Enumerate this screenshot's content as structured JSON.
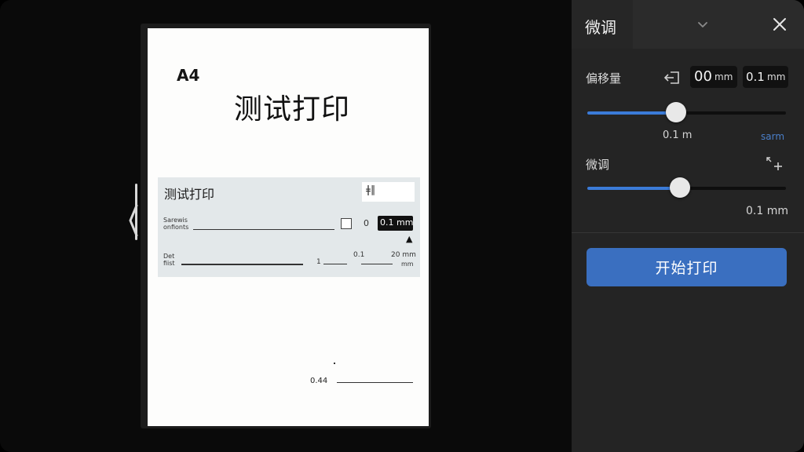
{
  "preview": {
    "paper_size": "A4",
    "title": "测试打印",
    "band": {
      "title": "测试打印",
      "glyph": "ǂ∥",
      "row1_label_a": "Sarewis",
      "row1_label_b": "onfionts",
      "small_num": "0",
      "value_pill": "0.1 mm",
      "row2_label_a": "Det",
      "row2_label_b": "fiist",
      "row2_num_1": "1",
      "row2_num_2": "0.1",
      "row2_num_3": "20 mm",
      "row2_unit": "mm"
    },
    "bottom_number": "0.44"
  },
  "panel": {
    "title": "微调",
    "offset": {
      "label": "偏移量",
      "value1_num": "00",
      "value1_unit": "mm",
      "value2_num": "0.1",
      "value2_unit": "mm",
      "slider_fraction": 0.447,
      "readout": "0.1 m",
      "readout_extra": "sarm"
    },
    "fine": {
      "label": "微调",
      "slider_fraction": 0.467,
      "readout": "0.1 mm"
    },
    "print_button": "开始打印"
  },
  "colors": {
    "accent": "#3b7bd8",
    "button": "#3a6fc0",
    "panel": "#242424"
  }
}
